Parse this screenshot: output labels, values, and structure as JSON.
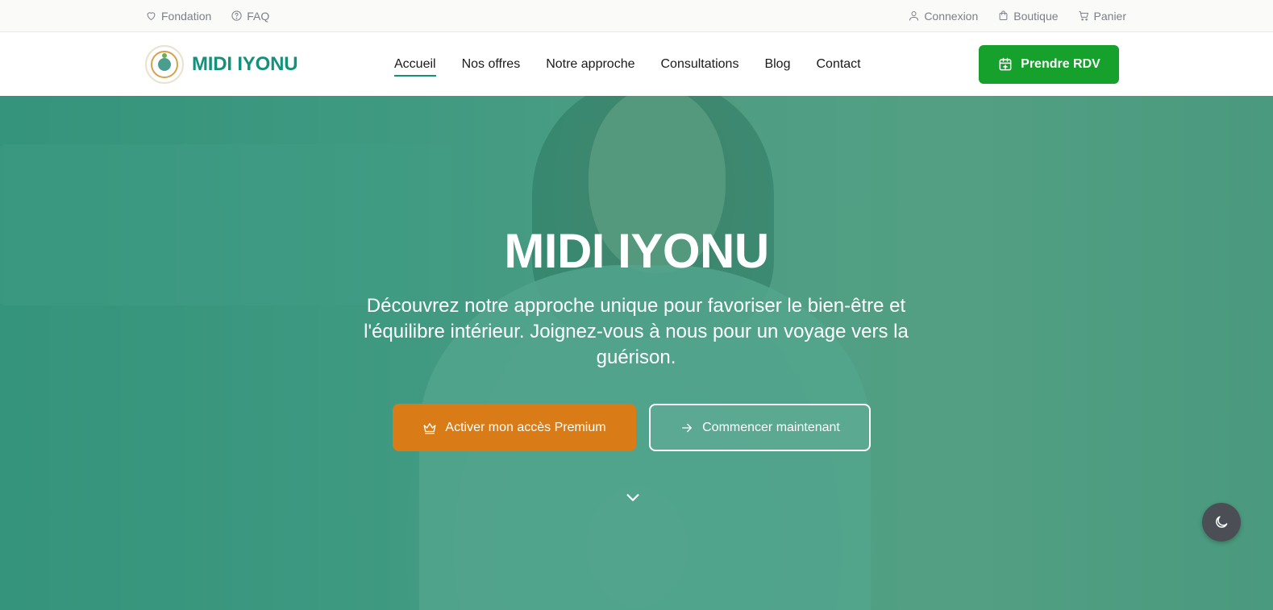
{
  "topbar": {
    "left_links": [
      {
        "label": "Fondation",
        "icon": "heart-icon"
      },
      {
        "label": "FAQ",
        "icon": "help-circle-icon"
      }
    ],
    "right_links": [
      {
        "label": "Connexion",
        "icon": "user-icon"
      },
      {
        "label": "Boutique",
        "icon": "shopping-bag-icon"
      },
      {
        "label": "Panier",
        "icon": "cart-icon"
      }
    ]
  },
  "header": {
    "brand_name": "MIDI IYONU",
    "nav": [
      {
        "label": "Accueil",
        "active": true
      },
      {
        "label": "Nos offres",
        "active": false
      },
      {
        "label": "Notre approche",
        "active": false
      },
      {
        "label": "Consultations",
        "active": false
      },
      {
        "label": "Blog",
        "active": false
      },
      {
        "label": "Contact",
        "active": false
      }
    ],
    "cta_label": "Prendre RDV",
    "cta_icon": "calendar-plus-icon"
  },
  "hero": {
    "title": "MIDI IYONU",
    "subtitle": "Découvrez notre approche unique pour favoriser le bien-être et l'équilibre intérieur. Joignez-vous à nous pour un voyage vers la guérison.",
    "premium_button": "Activer mon accès Premium",
    "premium_icon": "crown-icon",
    "start_button": "Commencer maintenant",
    "start_icon": "arrow-right-icon",
    "scroll_icon": "chevron-down-icon"
  },
  "theme_toggle": {
    "icon": "moon-icon"
  },
  "colors": {
    "brand_green": "#13917a",
    "cta_green": "#16a02c",
    "premium_orange": "#d97c17",
    "hero_overlay": "#26967880"
  }
}
